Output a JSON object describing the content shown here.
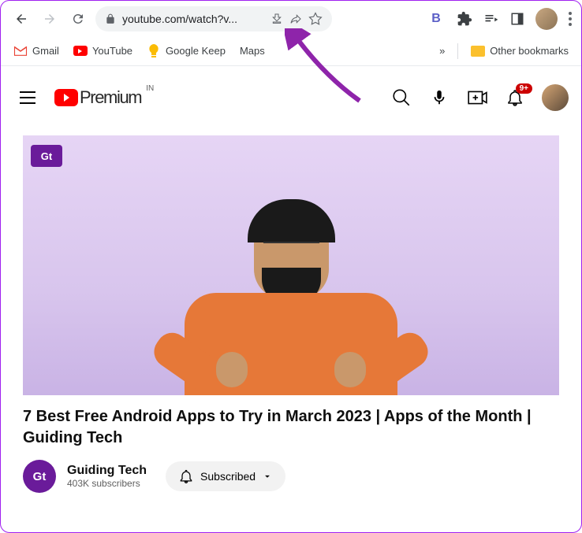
{
  "browser": {
    "url": "youtube.com/watch?v...",
    "bookmarks": {
      "gmail": "Gmail",
      "youtube": "YouTube",
      "keep": "Google Keep",
      "maps": "Maps",
      "other": "Other bookmarks",
      "overflow": "»"
    },
    "extensions": {
      "b_label": "B"
    }
  },
  "youtube": {
    "logo_text": "Premium",
    "country": "IN",
    "notif_count": "9+",
    "channel_logo": "Gt"
  },
  "video": {
    "title": "7 Best Free Android Apps to Try in March 2023 | Apps of the Month | Guiding Tech",
    "channel_name": "Guiding Tech",
    "channel_avatar": "Gt",
    "subscribers": "403K subscribers",
    "subscribe_label": "Subscribed"
  }
}
